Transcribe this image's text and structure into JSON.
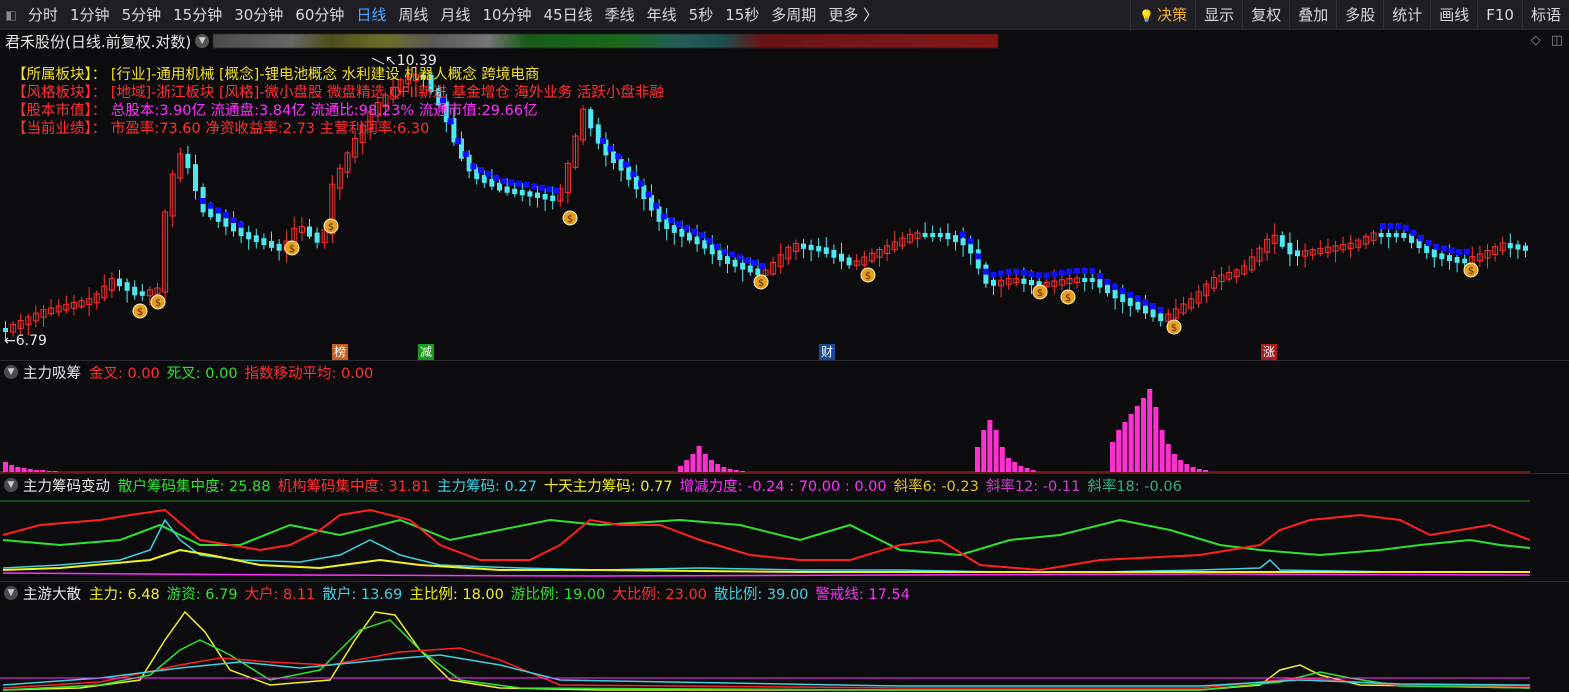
{
  "toolbar": {
    "periods": [
      "分时",
      "1分钟",
      "5分钟",
      "15分钟",
      "30分钟",
      "60分钟",
      "日线",
      "周线",
      "月线",
      "10分钟",
      "45日线",
      "季线",
      "年线",
      "5秒",
      "15秒",
      "多周期",
      "更多 〉"
    ],
    "active_period": "日线",
    "tools": [
      "决策",
      "显示",
      "复权",
      "叠加",
      "多股",
      "统计",
      "画线",
      "F10",
      "标语"
    ]
  },
  "title": "君禾股份(日线.前复权.对数)",
  "info": {
    "board_key": "【所属板块】：",
    "board_val": "[行业]-通用机械 [概念]-锂电池概念 水利建设 机器人概念 跨境电商",
    "style_key": "【风格板块】：",
    "style_val": "[地域]-浙江板块 [风格]-微小盘股 微盘精选 QFII新进 基金增仓 海外业务 活跃小盘非融",
    "cap_key": "【股本市值】：",
    "cap_val": "总股本:3.90亿 流通盘:3.84亿 流通比:98.23% 流通市值:29.66亿",
    "perf_key": "【当前业绩】：",
    "perf_val": "市盈率:73.60 净资收益率:2.73 主营利润率:6.30"
  },
  "price": {
    "high_label": "10.39",
    "low_label": "6.79",
    "high": 10.39,
    "low": 6.79
  },
  "markers": [
    {
      "text": "榜",
      "color": "#c86020"
    },
    {
      "text": "减",
      "color": "#1a9a1a"
    },
    {
      "text": "财",
      "color": "#1a4a9a"
    },
    {
      "text": "涨",
      "color": "#b01a1a"
    }
  ],
  "panel1": {
    "name": "主力吸筹",
    "indicators": [
      {
        "text": "金叉: 0.00",
        "color": "#ff3030"
      },
      {
        "text": "死叉: 0.00",
        "color": "#30e030"
      },
      {
        "text": "指数移动平均: 0.00",
        "color": "#ff3030"
      }
    ]
  },
  "panel2": {
    "name": "主力筹码变动",
    "indicators": [
      {
        "text": "散户筹码集中度: 25.88",
        "color": "#30e030"
      },
      {
        "text": "机构筹码集中度: 31.81",
        "color": "#ff3030"
      },
      {
        "text": "主力筹码: 0.27",
        "color": "#40d0e0"
      },
      {
        "text": "十天主力筹码: 0.77",
        "color": "#f0f020"
      },
      {
        "text": "增减力度: -0.24 : 70.00 : 0.00",
        "color": "#ff30ff"
      },
      {
        "text": "斜率6: -0.23",
        "color": "#e0c020"
      },
      {
        "text": "斜率12: -0.11",
        "color": "#d040d0"
      },
      {
        "text": "斜率18: -0.06",
        "color": "#30b080"
      }
    ]
  },
  "panel3": {
    "name": "主游大散",
    "indicators": [
      {
        "text": "主力: 6.48",
        "color": "#f0f020"
      },
      {
        "text": "游资: 6.79",
        "color": "#30e030"
      },
      {
        "text": "大户: 8.11",
        "color": "#ff3030"
      },
      {
        "text": "散户: 13.69",
        "color": "#40d0e0"
      },
      {
        "text": "主比例: 18.00",
        "color": "#f0f020"
      },
      {
        "text": "游比例: 19.00",
        "color": "#30e030"
      },
      {
        "text": "大比例: 23.00",
        "color": "#ff3030"
      },
      {
        "text": "散比例: 39.00",
        "color": "#40d0e0"
      },
      {
        "text": "警戒线: 17.54",
        "color": "#ff30ff"
      }
    ]
  },
  "colors": {
    "up": "#ff3030",
    "down": "#50e8f0",
    "signal": "#1010ff",
    "bar": "#ff30d0"
  }
}
